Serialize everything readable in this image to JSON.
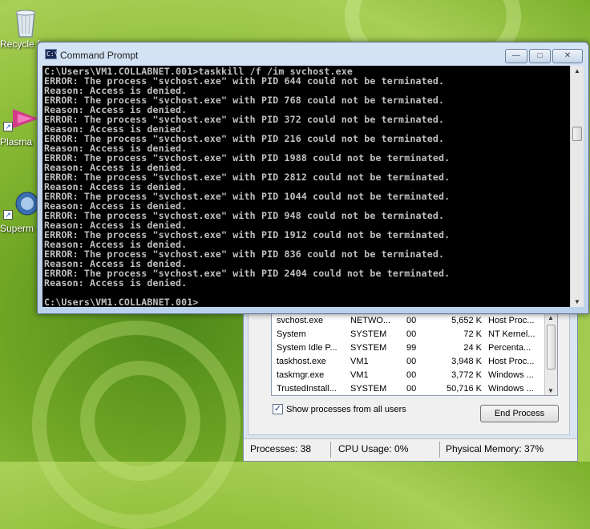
{
  "desktop": {
    "icons": [
      {
        "label": "Recycle Bin",
        "name": "recycle-bin-icon"
      },
      {
        "label": "Plasma",
        "name": "plasma-icon"
      },
      {
        "label": "Superm",
        "name": "superm-icon"
      }
    ]
  },
  "cmd": {
    "title": "Command Prompt",
    "icon_text": "C:\\",
    "lines": [
      "C:\\Users\\VM1.COLLABNET.001>taskkill /f /im svchost.exe",
      "ERROR: The process \"svchost.exe\" with PID 644 could not be terminated.",
      "Reason: Access is denied.",
      "ERROR: The process \"svchost.exe\" with PID 768 could not be terminated.",
      "Reason: Access is denied.",
      "ERROR: The process \"svchost.exe\" with PID 372 could not be terminated.",
      "Reason: Access is denied.",
      "ERROR: The process \"svchost.exe\" with PID 216 could not be terminated.",
      "Reason: Access is denied.",
      "ERROR: The process \"svchost.exe\" with PID 1988 could not be terminated.",
      "Reason: Access is denied.",
      "ERROR: The process \"svchost.exe\" with PID 2812 could not be terminated.",
      "Reason: Access is denied.",
      "ERROR: The process \"svchost.exe\" with PID 1044 could not be terminated.",
      "Reason: Access is denied.",
      "ERROR: The process \"svchost.exe\" with PID 948 could not be terminated.",
      "Reason: Access is denied.",
      "ERROR: The process \"svchost.exe\" with PID 1912 could not be terminated.",
      "Reason: Access is denied.",
      "ERROR: The process \"svchost.exe\" with PID 836 could not be terminated.",
      "Reason: Access is denied.",
      "ERROR: The process \"svchost.exe\" with PID 2404 could not be terminated.",
      "Reason: Access is denied.",
      "",
      "C:\\Users\\VM1.COLLABNET.001>"
    ],
    "buttons": {
      "minimize": "—",
      "maximize": "□",
      "close": "✕"
    }
  },
  "taskmgr": {
    "processes": [
      {
        "name": "svchost.exe",
        "user": "NETWO...",
        "cpu": "00",
        "mem": "5,652 K",
        "desc": "Host Proc..."
      },
      {
        "name": "System",
        "user": "SYSTEM",
        "cpu": "00",
        "mem": "72 K",
        "desc": "NT Kernel..."
      },
      {
        "name": "System Idle P...",
        "user": "SYSTEM",
        "cpu": "99",
        "mem": "24 K",
        "desc": "Percenta..."
      },
      {
        "name": "taskhost.exe",
        "user": "VM1",
        "cpu": "00",
        "mem": "3,948 K",
        "desc": "Host Proc..."
      },
      {
        "name": "taskmgr.exe",
        "user": "VM1",
        "cpu": "00",
        "mem": "3,772 K",
        "desc": "Windows ..."
      },
      {
        "name": "TrustedInstall...",
        "user": "SYSTEM",
        "cpu": "00",
        "mem": "50,716 K",
        "desc": "Windows ..."
      }
    ],
    "show_all_label": "Show processes from all users",
    "show_all_checked": "✓",
    "end_process_label": "End Process",
    "status": {
      "processes": "Processes: 38",
      "cpu": "CPU Usage: 0%",
      "memory": "Physical Memory: 37%"
    }
  },
  "colors": {
    "console_bg": "#000000",
    "console_fg": "#c0c0c0",
    "accent": "#c5d8ee"
  }
}
